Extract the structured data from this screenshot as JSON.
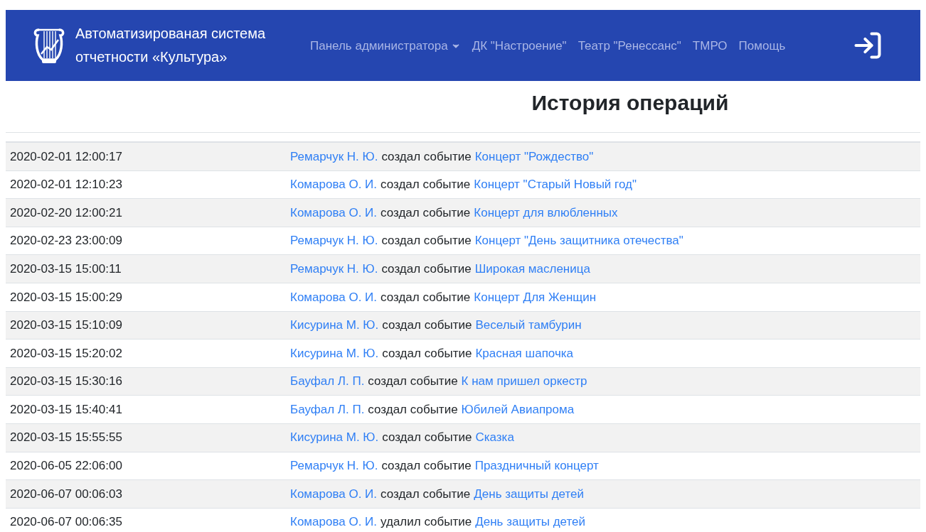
{
  "navbar": {
    "brand": "Автоматизированая система отчетности «Культура»",
    "items": [
      {
        "label": "Панель администратора",
        "kind": "dropdown"
      },
      {
        "label": "ДК \"Настроение\"",
        "kind": "link"
      },
      {
        "label": "Театр \"Ренессанс\"",
        "kind": "link"
      },
      {
        "label": "ТМРО",
        "kind": "link"
      },
      {
        "label": "Помощь",
        "kind": "link"
      }
    ]
  },
  "title": "История операций",
  "table": {
    "rows": [
      {
        "time": "2020-02-01 12:00:17",
        "user": "Ремарчук Н. Ю.",
        "action": "создал событие",
        "event": "Концерт \"Рождество\""
      },
      {
        "time": "2020-02-01 12:10:23",
        "user": "Комарова О. И.",
        "action": "создал событие",
        "event": "Концерт \"Старый Новый год\""
      },
      {
        "time": "2020-02-20 12:00:21",
        "user": "Комарова О. И.",
        "action": "создал событие",
        "event": "Концерт для влюбленных"
      },
      {
        "time": "2020-02-23 23:00:09",
        "user": "Ремарчук Н. Ю.",
        "action": "создал событие",
        "event": "Концерт \"День защитника отечества\""
      },
      {
        "time": "2020-03-15 15:00:11",
        "user": "Ремарчук Н. Ю.",
        "action": "создал событие",
        "event": "Широкая масленица"
      },
      {
        "time": "2020-03-15 15:00:29",
        "user": "Комарова О. И.",
        "action": "создал событие",
        "event": "Концерт Для Женщин"
      },
      {
        "time": "2020-03-15 15:10:09",
        "user": "Кисурина М. Ю.",
        "action": "создал событие",
        "event": "Веселый тамбурин"
      },
      {
        "time": "2020-03-15 15:20:02",
        "user": "Кисурина М. Ю.",
        "action": "создал событие",
        "event": "Красная шапочка"
      },
      {
        "time": "2020-03-15 15:30:16",
        "user": "Бауфал Л. П.",
        "action": "создал событие",
        "event": "К нам пришел оркестр"
      },
      {
        "time": "2020-03-15 15:40:41",
        "user": "Бауфал Л. П.",
        "action": "создал событие",
        "event": "Юбилей Авиапрома"
      },
      {
        "time": "2020-03-15 15:55:55",
        "user": "Кисурина М. Ю.",
        "action": "создал событие",
        "event": "Сказка"
      },
      {
        "time": "2020-06-05 22:06:00",
        "user": "Ремарчук Н. Ю.",
        "action": "создал событие",
        "event": "Праздничный концерт"
      },
      {
        "time": "2020-06-07 00:06:03",
        "user": "Комарова О. И.",
        "action": "создал событие",
        "event": "День защиты детей"
      },
      {
        "time": "2020-06-07 00:06:35",
        "user": "Комарова О. И.",
        "action": "удалил событие",
        "event": "День защиты детей"
      }
    ]
  }
}
